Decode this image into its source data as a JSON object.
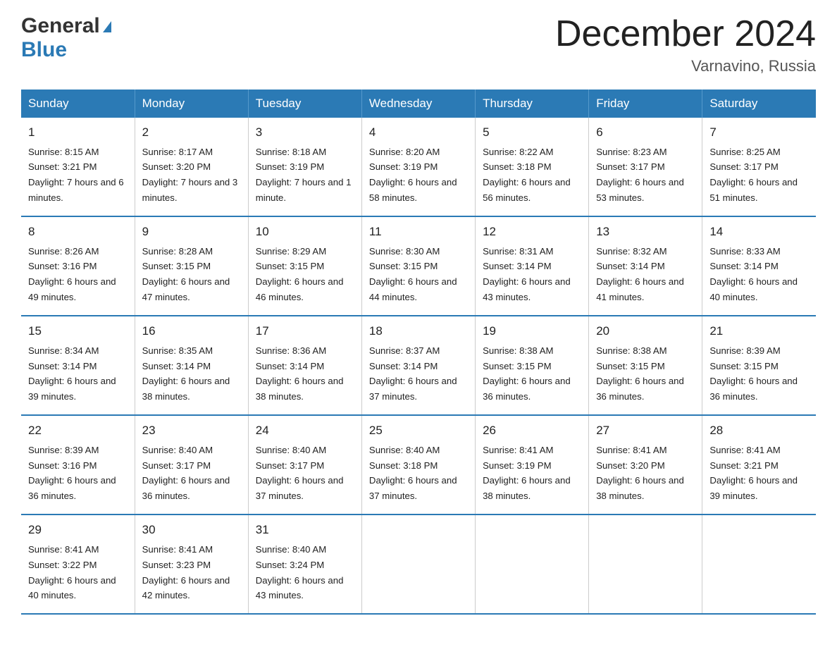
{
  "header": {
    "logo_general": "General",
    "logo_blue": "Blue",
    "month_year": "December 2024",
    "location": "Varnavino, Russia"
  },
  "days_of_week": [
    "Sunday",
    "Monday",
    "Tuesday",
    "Wednesday",
    "Thursday",
    "Friday",
    "Saturday"
  ],
  "weeks": [
    [
      {
        "day": "1",
        "sunrise": "8:15 AM",
        "sunset": "3:21 PM",
        "daylight": "7 hours and 6 minutes."
      },
      {
        "day": "2",
        "sunrise": "8:17 AM",
        "sunset": "3:20 PM",
        "daylight": "7 hours and 3 minutes."
      },
      {
        "day": "3",
        "sunrise": "8:18 AM",
        "sunset": "3:19 PM",
        "daylight": "7 hours and 1 minute."
      },
      {
        "day": "4",
        "sunrise": "8:20 AM",
        "sunset": "3:19 PM",
        "daylight": "6 hours and 58 minutes."
      },
      {
        "day": "5",
        "sunrise": "8:22 AM",
        "sunset": "3:18 PM",
        "daylight": "6 hours and 56 minutes."
      },
      {
        "day": "6",
        "sunrise": "8:23 AM",
        "sunset": "3:17 PM",
        "daylight": "6 hours and 53 minutes."
      },
      {
        "day": "7",
        "sunrise": "8:25 AM",
        "sunset": "3:17 PM",
        "daylight": "6 hours and 51 minutes."
      }
    ],
    [
      {
        "day": "8",
        "sunrise": "8:26 AM",
        "sunset": "3:16 PM",
        "daylight": "6 hours and 49 minutes."
      },
      {
        "day": "9",
        "sunrise": "8:28 AM",
        "sunset": "3:15 PM",
        "daylight": "6 hours and 47 minutes."
      },
      {
        "day": "10",
        "sunrise": "8:29 AM",
        "sunset": "3:15 PM",
        "daylight": "6 hours and 46 minutes."
      },
      {
        "day": "11",
        "sunrise": "8:30 AM",
        "sunset": "3:15 PM",
        "daylight": "6 hours and 44 minutes."
      },
      {
        "day": "12",
        "sunrise": "8:31 AM",
        "sunset": "3:14 PM",
        "daylight": "6 hours and 43 minutes."
      },
      {
        "day": "13",
        "sunrise": "8:32 AM",
        "sunset": "3:14 PM",
        "daylight": "6 hours and 41 minutes."
      },
      {
        "day": "14",
        "sunrise": "8:33 AM",
        "sunset": "3:14 PM",
        "daylight": "6 hours and 40 minutes."
      }
    ],
    [
      {
        "day": "15",
        "sunrise": "8:34 AM",
        "sunset": "3:14 PM",
        "daylight": "6 hours and 39 minutes."
      },
      {
        "day": "16",
        "sunrise": "8:35 AM",
        "sunset": "3:14 PM",
        "daylight": "6 hours and 38 minutes."
      },
      {
        "day": "17",
        "sunrise": "8:36 AM",
        "sunset": "3:14 PM",
        "daylight": "6 hours and 38 minutes."
      },
      {
        "day": "18",
        "sunrise": "8:37 AM",
        "sunset": "3:14 PM",
        "daylight": "6 hours and 37 minutes."
      },
      {
        "day": "19",
        "sunrise": "8:38 AM",
        "sunset": "3:15 PM",
        "daylight": "6 hours and 36 minutes."
      },
      {
        "day": "20",
        "sunrise": "8:38 AM",
        "sunset": "3:15 PM",
        "daylight": "6 hours and 36 minutes."
      },
      {
        "day": "21",
        "sunrise": "8:39 AM",
        "sunset": "3:15 PM",
        "daylight": "6 hours and 36 minutes."
      }
    ],
    [
      {
        "day": "22",
        "sunrise": "8:39 AM",
        "sunset": "3:16 PM",
        "daylight": "6 hours and 36 minutes."
      },
      {
        "day": "23",
        "sunrise": "8:40 AM",
        "sunset": "3:17 PM",
        "daylight": "6 hours and 36 minutes."
      },
      {
        "day": "24",
        "sunrise": "8:40 AM",
        "sunset": "3:17 PM",
        "daylight": "6 hours and 37 minutes."
      },
      {
        "day": "25",
        "sunrise": "8:40 AM",
        "sunset": "3:18 PM",
        "daylight": "6 hours and 37 minutes."
      },
      {
        "day": "26",
        "sunrise": "8:41 AM",
        "sunset": "3:19 PM",
        "daylight": "6 hours and 38 minutes."
      },
      {
        "day": "27",
        "sunrise": "8:41 AM",
        "sunset": "3:20 PM",
        "daylight": "6 hours and 38 minutes."
      },
      {
        "day": "28",
        "sunrise": "8:41 AM",
        "sunset": "3:21 PM",
        "daylight": "6 hours and 39 minutes."
      }
    ],
    [
      {
        "day": "29",
        "sunrise": "8:41 AM",
        "sunset": "3:22 PM",
        "daylight": "6 hours and 40 minutes."
      },
      {
        "day": "30",
        "sunrise": "8:41 AM",
        "sunset": "3:23 PM",
        "daylight": "6 hours and 42 minutes."
      },
      {
        "day": "31",
        "sunrise": "8:40 AM",
        "sunset": "3:24 PM",
        "daylight": "6 hours and 43 minutes."
      },
      null,
      null,
      null,
      null
    ]
  ]
}
